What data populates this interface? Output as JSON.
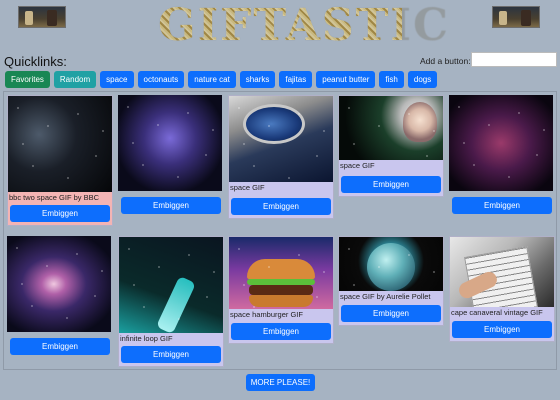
{
  "header": {
    "logo_text": "GIFTASTIC"
  },
  "quicklinks": {
    "label": "Quicklinks:",
    "buttons": [
      "Favorites",
      "Random",
      "space",
      "octonauts",
      "nature cat",
      "sharks",
      "fajitas",
      "peanut butter",
      "fish",
      "dogs"
    ]
  },
  "add": {
    "label": "Add a button:",
    "input_value": ""
  },
  "cards": [
    {
      "caption": "bbc two space GIF by BBC",
      "button": "Embiggen"
    },
    {
      "caption": "",
      "button": "Embiggen"
    },
    {
      "caption": "space GIF",
      "button": "Embiggen"
    },
    {
      "caption": "space GIF",
      "button": "Embiggen"
    },
    {
      "caption": "",
      "button": "Embiggen"
    },
    {
      "caption": "",
      "button": "Embiggen"
    },
    {
      "caption": "infinite loop GIF",
      "button": "Embiggen"
    },
    {
      "caption": "space hamburger GIF",
      "button": "Embiggen"
    },
    {
      "caption": "space GIF by Aurelie Pollet",
      "button": "Embiggen"
    },
    {
      "caption": "cape canaveral vintage GIF",
      "button": "Embiggen"
    }
  ],
  "more_button": "MORE PLEASE!",
  "colors": {
    "page_bg": "#a6b3c2",
    "primary": "#0d6efd",
    "favorites": "#198754",
    "random": "#20a1a4",
    "card_bg": "#c9c6ee",
    "card_bg_first": "#f3b4b4"
  }
}
